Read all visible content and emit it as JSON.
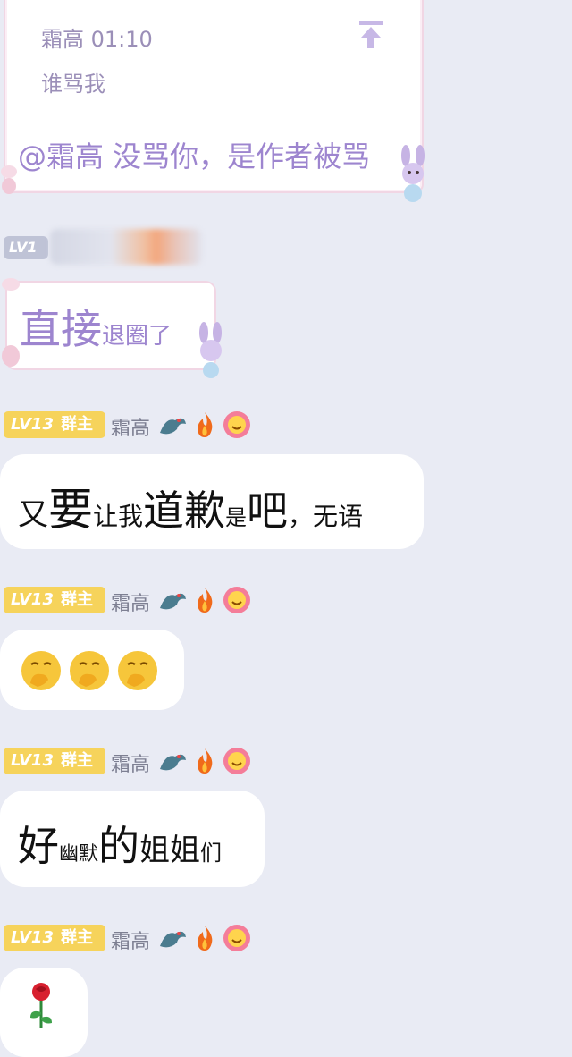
{
  "colors": {
    "background": "#e9ebf4",
    "badge_gold": "#f6d35b",
    "pink_text": "#9d85cf"
  },
  "quote": {
    "meta": "霜高 01:10",
    "text": "谁骂我",
    "reply": "@霜高 没骂你，是作者被骂"
  },
  "blurred_user": {
    "level": "LV1"
  },
  "message_quit": {
    "big": "直接",
    "small": "退圈了"
  },
  "sender": {
    "level": "LV13",
    "role": "群主",
    "name": "霜高"
  },
  "icons": [
    "dragon-icon",
    "fire-icon",
    "flower-smiley-icon"
  ],
  "messages": [
    {
      "parts": [
        [
          "又",
          "m"
        ],
        [
          "要",
          "l"
        ],
        [
          "让我",
          "s"
        ],
        [
          "道歉",
          "l"
        ],
        [
          "是",
          "s"
        ],
        [
          "吧",
          "l"
        ],
        [
          "，",
          "m"
        ],
        [
          "无语",
          "s"
        ]
      ]
    },
    {
      "emoji": [
        "face-with-hand-over-mouth-icon",
        "face-with-hand-over-mouth-icon",
        "face-with-hand-over-mouth-icon"
      ]
    },
    {
      "parts": [
        [
          "好",
          "l"
        ],
        [
          "幽默",
          "s"
        ],
        [
          "的",
          "l"
        ],
        [
          "姐姐",
          "m"
        ],
        [
          "们",
          "s"
        ]
      ]
    },
    {
      "emoji": [
        "rose-icon"
      ]
    }
  ],
  "text_fragments": {
    "m1": [
      "又",
      "要",
      "让我",
      "道歉",
      "是",
      "吧",
      "，",
      "无语"
    ],
    "m3": [
      "好",
      "幽默",
      "的",
      "姐姐",
      "们"
    ]
  }
}
